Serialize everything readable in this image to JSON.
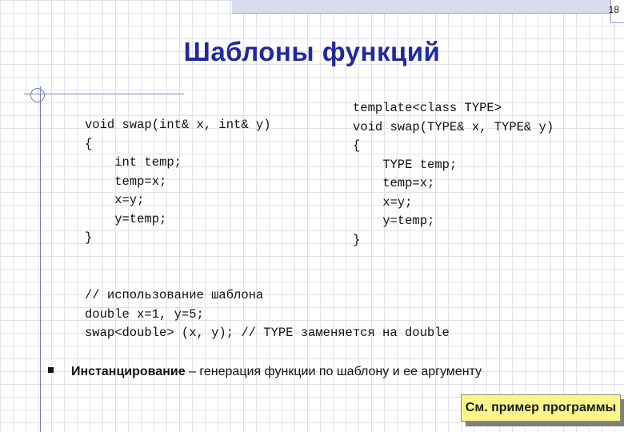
{
  "slide": {
    "page_number": "18",
    "title": "Шаблоны функций"
  },
  "code_left": {
    "lines": [
      "void swap(int& x, int& y)",
      "{",
      "    int temp;",
      "    temp=x;",
      "    x=y;",
      "    y=temp;",
      "}"
    ]
  },
  "code_right": {
    "lines": [
      "template<class TYPE>",
      "void swap(TYPE& x, TYPE& y)",
      "{",
      "    TYPE temp;",
      "    temp=x;",
      "    x=y;",
      "    y=temp;",
      "}"
    ]
  },
  "code_usage": {
    "lines": [
      "// использование шаблона",
      "double x=1, y=5;",
      "swap<double> (x, y); // TYPE заменяется на double"
    ]
  },
  "bullet": {
    "term": "Инстанцирование",
    "text": " – генерация функции по шаблону и ее аргументу"
  },
  "example_button": {
    "label": "См. пример программы"
  }
}
